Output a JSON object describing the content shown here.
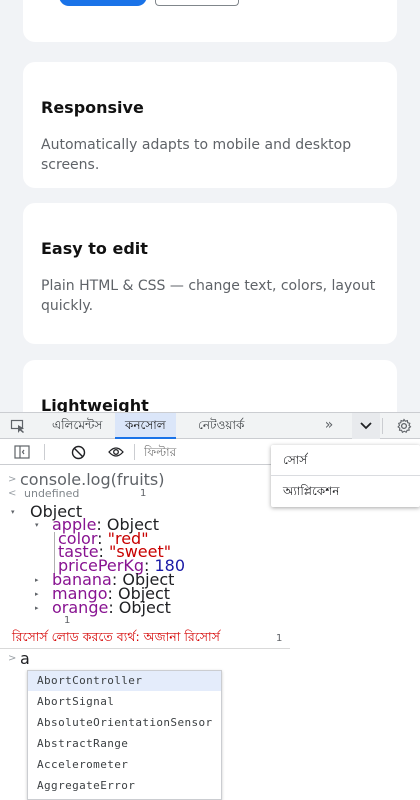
{
  "page": {
    "cards": [
      {
        "title": "Responsive",
        "text": "Automatically adapts to mobile and desktop screens."
      },
      {
        "title": "Easy to edit",
        "text": "Plain HTML & CSS — change text, colors, layout quickly."
      },
      {
        "title": "Lightweight",
        "text": ""
      }
    ]
  },
  "devtools": {
    "tabs": [
      "এলিমেন্টস",
      "কনসোল",
      "নেটওয়ার্ক"
    ],
    "active_tab": "কনসোল",
    "more_label": "»",
    "filter_placeholder": "ফিল্টার",
    "overflow_menu": [
      "সোর্স",
      "অ্যাপ্লিকেশন"
    ],
    "console": {
      "command": "console.log(fruits)",
      "result": "undefined",
      "result_count": "1",
      "object_label": "Object",
      "apple_key": "apple",
      "apple_value": "Object",
      "apple_props": [
        {
          "key": "color",
          "value": "\"red\""
        },
        {
          "key": "taste",
          "value": "\"sweet\""
        },
        {
          "key": "pricePerKg",
          "value": "180"
        }
      ],
      "others": [
        {
          "key": "banana",
          "value": "Object"
        },
        {
          "key": "mango",
          "value": "Object"
        },
        {
          "key": "orange",
          "value": "Object"
        }
      ],
      "group_count": "1",
      "error_text": "রিসোর্স লোড করতে ব্যর্থ: অজানা রিসোর্স",
      "error_count": "1",
      "input_value": "a"
    },
    "autocomplete": [
      "AbortController",
      "AbortSignal",
      "AbsoluteOrientationSensor",
      "AbstractRange",
      "Accelerometer",
      "AggregateError"
    ]
  }
}
